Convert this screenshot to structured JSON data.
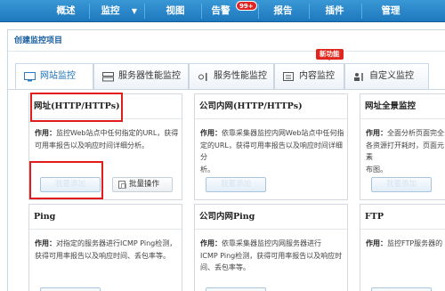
{
  "topnav": {
    "items": [
      "概述",
      "监控",
      "视图",
      "告警",
      "报告",
      "插件",
      "管理"
    ],
    "caret": "▼",
    "alert_badge": "99+"
  },
  "panel": {
    "title": "创建监控项目"
  },
  "tabs": {
    "items": [
      "网站监控",
      "服务器性能监控",
      "服务性能监控",
      "内容监控",
      "自定义监控"
    ],
    "new_badge": "新功能",
    "active_index": 0
  },
  "cards": [
    {
      "title": "网址(HTTP/HTTPs)",
      "desc_label": "作用：",
      "desc": [
        "监控Web站点中任何指定的URL，获得",
        "可用率报告以及响应时间详细分析。"
      ],
      "open_label": "我要添加",
      "batch_label": "批量操作"
    },
    {
      "title": "公司内网(HTTP/HTTPs)",
      "desc_label": "作用：",
      "desc": [
        "依靠采集器监控内网Web站点中任何指",
        "定的URL，获得可用率报告以及响应时间详细分",
        "析。"
      ],
      "open_label": "我要添加"
    },
    {
      "title": "网址全景监控",
      "desc_label": "作用：",
      "desc": [
        "全面分析页面完全",
        "各资源打开耗时，页面元素",
        "布图。"
      ],
      "open_label": "我要添加"
    },
    {
      "title": "Ping",
      "desc_label": "作用：",
      "desc": [
        "对指定的服务器进行ICMP Ping检测，",
        "获得可用率报告以及响应时间、丢包率等。"
      ]
    },
    {
      "title": "公司内网Ping",
      "desc_label": "作用：",
      "desc": [
        "依靠采集器监控内网服务器进行",
        "ICMP Ping检测，获得可用率报告以及响应时",
        "间、丢包率等。"
      ]
    },
    {
      "title": "FTP",
      "desc_label": "作用：",
      "desc": [
        "监控FTP服务器的"
      ]
    }
  ],
  "colors": {
    "nav_bg": "#2a88ca",
    "accent": "#1a6fb5",
    "highlight": "#e31b1b",
    "badge": "#e0261c"
  }
}
